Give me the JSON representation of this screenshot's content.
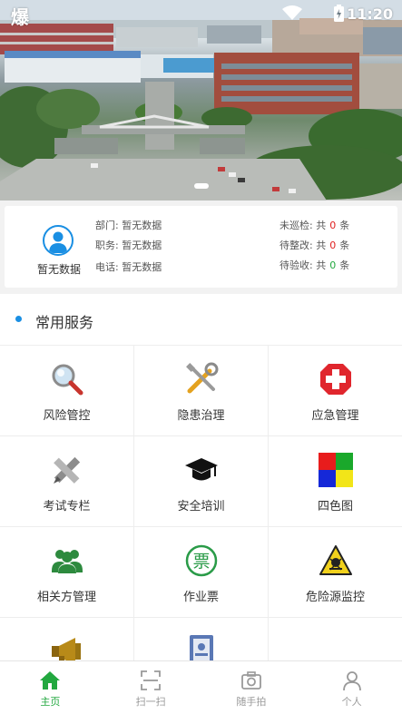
{
  "status_bar": {
    "left_glyph": "爆",
    "time": "11:20"
  },
  "banner": {
    "slide_count": 3,
    "active_slide": 1
  },
  "user_card": {
    "name": "暂无数据",
    "department_label": "部门:",
    "department_value": "暂无数据",
    "position_label": "职务:",
    "position_value": "暂无数据",
    "phone_label": "电话:",
    "phone_value": "暂无数据",
    "stats": [
      {
        "label": "未巡检:",
        "prefix": "共",
        "count": "0",
        "suffix": "条",
        "color": "#e02020"
      },
      {
        "label": "待整改:",
        "prefix": "共",
        "count": "0",
        "suffix": "条",
        "color": "#e02020"
      },
      {
        "label": "待验收:",
        "prefix": "共",
        "count": "0",
        "suffix": "条",
        "color": "#22a83f"
      }
    ]
  },
  "services": {
    "title": "常用服务",
    "items": [
      {
        "label": "风险管控",
        "icon": "magnifier-icon"
      },
      {
        "label": "隐患治理",
        "icon": "tools-icon"
      },
      {
        "label": "应急管理",
        "icon": "red-cross-icon"
      },
      {
        "label": "考试专栏",
        "icon": "pencil-ruler-icon"
      },
      {
        "label": "安全培训",
        "icon": "graduation-cap-icon"
      },
      {
        "label": "四色图",
        "icon": "four-color-icon"
      },
      {
        "label": "相关方管理",
        "icon": "people-icon"
      },
      {
        "label": "作业票",
        "icon": "ticket-icon"
      },
      {
        "label": "危险源监控",
        "icon": "hazard-icon"
      },
      {
        "label": "",
        "icon": "megaphone-icon"
      },
      {
        "label": "",
        "icon": "id-card-icon"
      },
      {
        "label": "",
        "icon": ""
      }
    ]
  },
  "tabbar": {
    "items": [
      {
        "label": "主页",
        "icon": "home-icon",
        "active": true
      },
      {
        "label": "扫一扫",
        "icon": "scan-icon",
        "active": false
      },
      {
        "label": "随手拍",
        "icon": "camera-icon",
        "active": false
      },
      {
        "label": "个人",
        "icon": "person-icon",
        "active": false
      }
    ]
  },
  "colors": {
    "accent": "#1a8fe3",
    "active_tab": "#22a83f",
    "alert_red": "#e02020"
  }
}
